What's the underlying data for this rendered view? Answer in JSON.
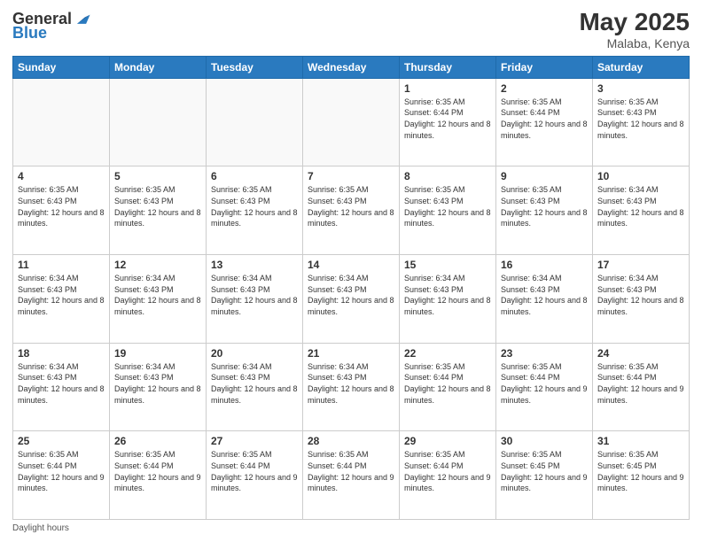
{
  "header": {
    "logo_general": "General",
    "logo_blue": "Blue",
    "title": "May 2025",
    "location": "Malaba, Kenya"
  },
  "days_of_week": [
    "Sunday",
    "Monday",
    "Tuesday",
    "Wednesday",
    "Thursday",
    "Friday",
    "Saturday"
  ],
  "weeks": [
    [
      {
        "day": "",
        "info": ""
      },
      {
        "day": "",
        "info": ""
      },
      {
        "day": "",
        "info": ""
      },
      {
        "day": "",
        "info": ""
      },
      {
        "day": "1",
        "sunrise": "Sunrise: 6:35 AM",
        "sunset": "Sunset: 6:44 PM",
        "daylight": "Daylight: 12 hours and 8 minutes."
      },
      {
        "day": "2",
        "sunrise": "Sunrise: 6:35 AM",
        "sunset": "Sunset: 6:44 PM",
        "daylight": "Daylight: 12 hours and 8 minutes."
      },
      {
        "day": "3",
        "sunrise": "Sunrise: 6:35 AM",
        "sunset": "Sunset: 6:43 PM",
        "daylight": "Daylight: 12 hours and 8 minutes."
      }
    ],
    [
      {
        "day": "4",
        "sunrise": "Sunrise: 6:35 AM",
        "sunset": "Sunset: 6:43 PM",
        "daylight": "Daylight: 12 hours and 8 minutes."
      },
      {
        "day": "5",
        "sunrise": "Sunrise: 6:35 AM",
        "sunset": "Sunset: 6:43 PM",
        "daylight": "Daylight: 12 hours and 8 minutes."
      },
      {
        "day": "6",
        "sunrise": "Sunrise: 6:35 AM",
        "sunset": "Sunset: 6:43 PM",
        "daylight": "Daylight: 12 hours and 8 minutes."
      },
      {
        "day": "7",
        "sunrise": "Sunrise: 6:35 AM",
        "sunset": "Sunset: 6:43 PM",
        "daylight": "Daylight: 12 hours and 8 minutes."
      },
      {
        "day": "8",
        "sunrise": "Sunrise: 6:35 AM",
        "sunset": "Sunset: 6:43 PM",
        "daylight": "Daylight: 12 hours and 8 minutes."
      },
      {
        "day": "9",
        "sunrise": "Sunrise: 6:35 AM",
        "sunset": "Sunset: 6:43 PM",
        "daylight": "Daylight: 12 hours and 8 minutes."
      },
      {
        "day": "10",
        "sunrise": "Sunrise: 6:34 AM",
        "sunset": "Sunset: 6:43 PM",
        "daylight": "Daylight: 12 hours and 8 minutes."
      }
    ],
    [
      {
        "day": "11",
        "sunrise": "Sunrise: 6:34 AM",
        "sunset": "Sunset: 6:43 PM",
        "daylight": "Daylight: 12 hours and 8 minutes."
      },
      {
        "day": "12",
        "sunrise": "Sunrise: 6:34 AM",
        "sunset": "Sunset: 6:43 PM",
        "daylight": "Daylight: 12 hours and 8 minutes."
      },
      {
        "day": "13",
        "sunrise": "Sunrise: 6:34 AM",
        "sunset": "Sunset: 6:43 PM",
        "daylight": "Daylight: 12 hours and 8 minutes."
      },
      {
        "day": "14",
        "sunrise": "Sunrise: 6:34 AM",
        "sunset": "Sunset: 6:43 PM",
        "daylight": "Daylight: 12 hours and 8 minutes."
      },
      {
        "day": "15",
        "sunrise": "Sunrise: 6:34 AM",
        "sunset": "Sunset: 6:43 PM",
        "daylight": "Daylight: 12 hours and 8 minutes."
      },
      {
        "day": "16",
        "sunrise": "Sunrise: 6:34 AM",
        "sunset": "Sunset: 6:43 PM",
        "daylight": "Daylight: 12 hours and 8 minutes."
      },
      {
        "day": "17",
        "sunrise": "Sunrise: 6:34 AM",
        "sunset": "Sunset: 6:43 PM",
        "daylight": "Daylight: 12 hours and 8 minutes."
      }
    ],
    [
      {
        "day": "18",
        "sunrise": "Sunrise: 6:34 AM",
        "sunset": "Sunset: 6:43 PM",
        "daylight": "Daylight: 12 hours and 8 minutes."
      },
      {
        "day": "19",
        "sunrise": "Sunrise: 6:34 AM",
        "sunset": "Sunset: 6:43 PM",
        "daylight": "Daylight: 12 hours and 8 minutes."
      },
      {
        "day": "20",
        "sunrise": "Sunrise: 6:34 AM",
        "sunset": "Sunset: 6:43 PM",
        "daylight": "Daylight: 12 hours and 8 minutes."
      },
      {
        "day": "21",
        "sunrise": "Sunrise: 6:34 AM",
        "sunset": "Sunset: 6:43 PM",
        "daylight": "Daylight: 12 hours and 8 minutes."
      },
      {
        "day": "22",
        "sunrise": "Sunrise: 6:35 AM",
        "sunset": "Sunset: 6:44 PM",
        "daylight": "Daylight: 12 hours and 8 minutes."
      },
      {
        "day": "23",
        "sunrise": "Sunrise: 6:35 AM",
        "sunset": "Sunset: 6:44 PM",
        "daylight": "Daylight: 12 hours and 9 minutes."
      },
      {
        "day": "24",
        "sunrise": "Sunrise: 6:35 AM",
        "sunset": "Sunset: 6:44 PM",
        "daylight": "Daylight: 12 hours and 9 minutes."
      }
    ],
    [
      {
        "day": "25",
        "sunrise": "Sunrise: 6:35 AM",
        "sunset": "Sunset: 6:44 PM",
        "daylight": "Daylight: 12 hours and 9 minutes."
      },
      {
        "day": "26",
        "sunrise": "Sunrise: 6:35 AM",
        "sunset": "Sunset: 6:44 PM",
        "daylight": "Daylight: 12 hours and 9 minutes."
      },
      {
        "day": "27",
        "sunrise": "Sunrise: 6:35 AM",
        "sunset": "Sunset: 6:44 PM",
        "daylight": "Daylight: 12 hours and 9 minutes."
      },
      {
        "day": "28",
        "sunrise": "Sunrise: 6:35 AM",
        "sunset": "Sunset: 6:44 PM",
        "daylight": "Daylight: 12 hours and 9 minutes."
      },
      {
        "day": "29",
        "sunrise": "Sunrise: 6:35 AM",
        "sunset": "Sunset: 6:44 PM",
        "daylight": "Daylight: 12 hours and 9 minutes."
      },
      {
        "day": "30",
        "sunrise": "Sunrise: 6:35 AM",
        "sunset": "Sunset: 6:45 PM",
        "daylight": "Daylight: 12 hours and 9 minutes."
      },
      {
        "day": "31",
        "sunrise": "Sunrise: 6:35 AM",
        "sunset": "Sunset: 6:45 PM",
        "daylight": "Daylight: 12 hours and 9 minutes."
      }
    ]
  ],
  "footer": {
    "note": "Daylight hours"
  }
}
